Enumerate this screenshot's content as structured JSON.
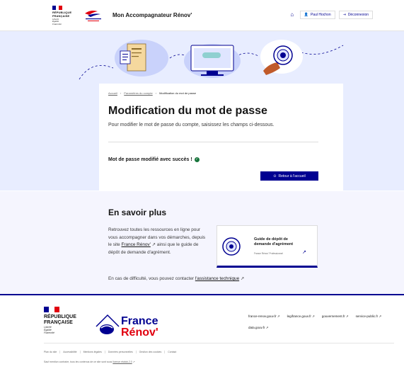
{
  "header": {
    "republic": {
      "line1": "RÉPUBLIQUE",
      "line2": "FRANÇAISE",
      "motto": [
        "Liberté",
        "Égalité",
        "Fraternité"
      ]
    },
    "app_title": "Mon Accompagnateur Rénov'",
    "user_label": "Paul Hochon",
    "logout_label": "Déconnexion"
  },
  "breadcrumb": {
    "home": "Accueil",
    "account": "Paramètres du compte",
    "current": "Modification du mot de passe"
  },
  "main": {
    "title": "Modification du mot de passe",
    "lead": "Pour modifier le mot de passe du compte, saisissez les champs ci-dessous.",
    "success": "Mot de passe modifié avec succès !",
    "back_button": "Retour à l'accueil"
  },
  "know_more": {
    "title": "En savoir plus",
    "text_before": "Retrouvez toutes les ressources en ligne pour vous accompagner dans vos démarches, depuis le site ",
    "link_site": "France Rénov'",
    "text_after": " ainsi que le guide de dépôt de demande d'agrément.",
    "contact_before": "En cas de difficulté, vous pouvez contacter ",
    "contact_link": "l'assistance technique",
    "guide_title": "Guide de dépôt de demande d'agrément",
    "guide_sub": "France Rénov' Professionnel"
  },
  "footer": {
    "logo_line1": "France",
    "logo_line2": "Rénov'",
    "links": [
      "france-renov.gouv.fr",
      "legifrance.gouv.fr",
      "gouvernement.fr",
      "service-public.fr",
      "data.gouv.fr"
    ],
    "bottom_links": [
      "Plan du site",
      "Accessibilité",
      "Mentions légales",
      "Données personnelles",
      "Gestion des cookies",
      "Contact"
    ],
    "license_before": "Sauf mention contraire, tous les contenus de ce site sont sous ",
    "license_link": "licence etalab-2.0"
  },
  "colors": {
    "primary": "#000091",
    "red": "#e1000f",
    "success": "#18753c",
    "banner": "#e8edff",
    "section": "#f5f5fe"
  }
}
